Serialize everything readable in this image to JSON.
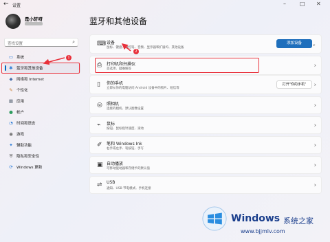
{
  "window": {
    "back_icon": "←",
    "title": "设置",
    "minimize": "–",
    "maximize": "□",
    "close": "✕"
  },
  "user": {
    "name": "是小轩呀"
  },
  "search": {
    "placeholder": "查找设置",
    "icon": "⌕"
  },
  "nav": {
    "items": [
      {
        "label": "系统",
        "icon": "▭",
        "color": "#2b7bd6"
      },
      {
        "label": "蓝牙和其他设备",
        "icon": "✱",
        "color": "#2b7bd6"
      },
      {
        "label": "网络和 Internet",
        "icon": "◆",
        "color": "#4a6fa8"
      },
      {
        "label": "个性化",
        "icon": "✎",
        "color": "#c77d2e"
      },
      {
        "label": "应用",
        "icon": "▦",
        "color": "#5d6a78"
      },
      {
        "label": "帐户",
        "icon": "●",
        "color": "#2e9c5e"
      },
      {
        "label": "时间和语言",
        "icon": "◔",
        "color": "#2b7bd6"
      },
      {
        "label": "游戏",
        "icon": "◉",
        "color": "#6e6e6e"
      },
      {
        "label": "辅助功能",
        "icon": "✦",
        "color": "#2b7bd6"
      },
      {
        "label": "隐私和安全性",
        "icon": "⛨",
        "color": "#555"
      },
      {
        "label": "Windows 更新",
        "icon": "⟳",
        "color": "#2b7bd6"
      }
    ]
  },
  "page_title": "蓝牙和其他设备",
  "cards": {
    "devices": {
      "icon": "⌨",
      "title": "设备",
      "subtitle": "鼠标、键盘、触控笔、音频、显示器和扩展坞、其他设备",
      "button": "添加设备",
      "chevron": "⌄"
    },
    "printers": {
      "icon": "⎙",
      "title": "打印机和扫描仪",
      "subtitle": "首选项、疑难解答",
      "chevron": "›"
    },
    "phone": {
      "icon": "▯",
      "title": "你的手机",
      "subtitle": "立即从你的电脑访问 Android 设备中的照片、短信等",
      "button": "打开\"你的手机\"",
      "chevron": "›"
    },
    "camera": {
      "icon": "◎",
      "title": "照相机",
      "subtitle": "连接的相机、默认图像设置",
      "chevron": "›"
    },
    "mouse": {
      "icon": "⌁",
      "title": "鼠标",
      "subtitle": "按钮、鼠标指针速度、滚动",
      "chevron": "›"
    },
    "pen": {
      "icon": "✐",
      "title": "笔和 Windows Ink",
      "subtitle": "右手或左手、笔按钮、手写",
      "chevron": "›"
    },
    "autoplay": {
      "icon": "▣",
      "title": "自动播放",
      "subtitle": "可移动驱动器和存储卡的默认值",
      "chevron": "›"
    },
    "usb": {
      "icon": "⇌",
      "title": "USB",
      "subtitle": "通知、USB 节电模式、手机连接",
      "chevron": "›"
    }
  },
  "annotations": {
    "badge1": "1",
    "badge2": "2"
  },
  "watermark": {
    "brand": "Windows",
    "cn": "系统之家",
    "url": "www.bjjmlv.com"
  }
}
